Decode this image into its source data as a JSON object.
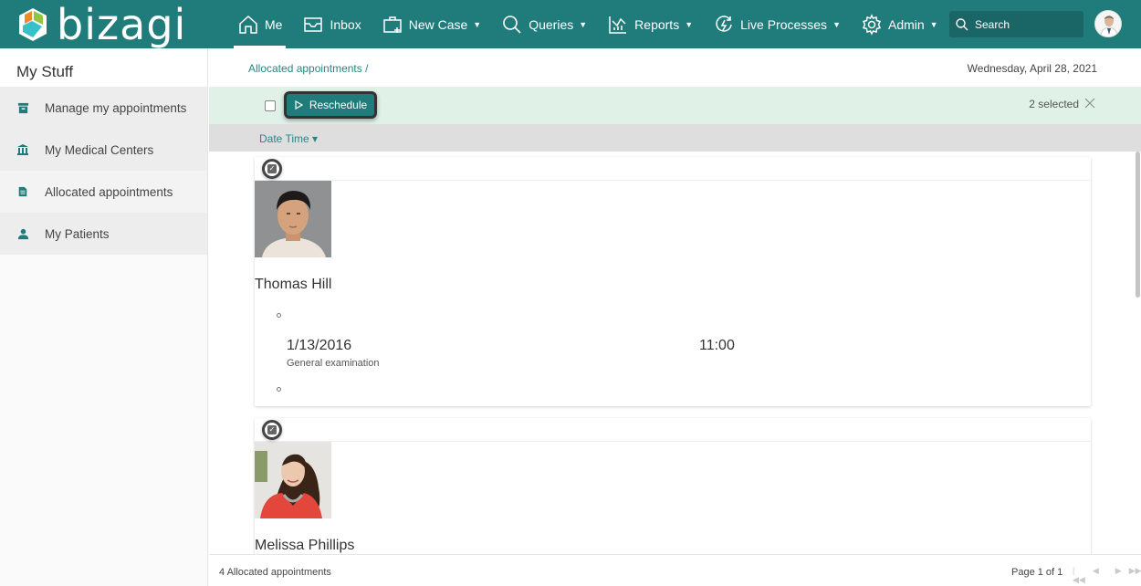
{
  "app": {
    "brand": "bizagi",
    "colors": {
      "primary": "#207b7b",
      "action_bar": "#e0f1e8",
      "link": "#2a8585",
      "logo_orange": "#f08a24",
      "logo_green": "#8dc63f",
      "logo_cyan": "#36c0c9",
      "logo_teal": "#1d9aa6"
    }
  },
  "topnav": {
    "items": [
      {
        "label": "Me",
        "icon": "home-icon",
        "active": true,
        "dropdown": false
      },
      {
        "label": "Inbox",
        "icon": "inbox-icon",
        "active": false,
        "dropdown": false
      },
      {
        "label": "New Case",
        "icon": "new-case-icon",
        "active": false,
        "dropdown": true
      },
      {
        "label": "Queries",
        "icon": "search-icon",
        "active": false,
        "dropdown": true
      },
      {
        "label": "Reports",
        "icon": "reports-chart-icon",
        "active": false,
        "dropdown": true
      },
      {
        "label": "Live Processes",
        "icon": "live-processes-icon",
        "active": false,
        "dropdown": true
      },
      {
        "label": "Admin",
        "icon": "gear-icon",
        "active": false,
        "dropdown": true
      }
    ],
    "search_placeholder": "Search",
    "caret": "▼"
  },
  "sidebar": {
    "title": "My Stuff",
    "items": [
      {
        "label": "Manage my appointments",
        "icon": "archive-box-icon"
      },
      {
        "label": "My Medical Centers",
        "icon": "institution-icon"
      },
      {
        "label": "Allocated appointments",
        "icon": "document-icon"
      },
      {
        "label": "My Patients",
        "icon": "user-icon"
      }
    ]
  },
  "main": {
    "breadcrumb": "Allocated appointments /",
    "date": "Wednesday, April 28, 2021",
    "actionbar": {
      "reschedule_label": "Reschedule",
      "selected_text": "2 selected"
    },
    "sort_label": "Date Time ▾",
    "cards": [
      {
        "name": "Thomas Hill",
        "selected": true,
        "appointment": {
          "date": "1/13/2016",
          "description": "General examination",
          "time": "11:00"
        }
      },
      {
        "name": "Melissa Phillips",
        "selected": true
      }
    ],
    "footer": {
      "count_text": "4 Allocated appointments",
      "page_text": "Page 1 of 1",
      "first": "|◀◀",
      "prev": "◀",
      "next": "▶",
      "last": "▶▶|"
    }
  }
}
